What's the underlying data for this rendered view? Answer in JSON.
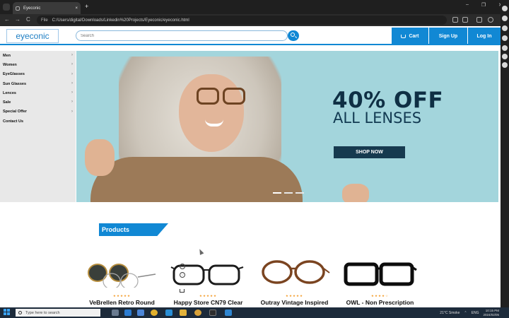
{
  "browser": {
    "tab_title": "Eyeconic",
    "tab_close": "×",
    "new_tab": "+",
    "file_chip": "File",
    "url": "C:/Users/digital/Downloads/Linkedin%20Projects/Eyeconic/eyeconic.html",
    "nav": {
      "back": "←",
      "forward": "→",
      "reload": "C"
    },
    "window": {
      "minimize": "–",
      "maximize": "❐",
      "close": "✕"
    }
  },
  "header": {
    "logo": "eyeconic",
    "search_placeholder": "Search",
    "cart_label": "Cart",
    "signup_label": "Sign Up",
    "login_label": "Log In"
  },
  "sidebar": {
    "items": [
      {
        "label": "Men"
      },
      {
        "label": "Women"
      },
      {
        "label": "EyeGlasses"
      },
      {
        "label": "Sun Glasses"
      },
      {
        "label": "Lences"
      },
      {
        "label": "Sale"
      },
      {
        "label": "Special Offer"
      },
      {
        "label": "Contact Us"
      }
    ],
    "chevron": "›"
  },
  "hero": {
    "headline": "40% OFF",
    "subheadline": "ALL LENSES",
    "cta": "SHOP NOW"
  },
  "products": {
    "section_title": "Products",
    "items": [
      {
        "name": "VeBrellen Retro Round",
        "stars": "★★★★★"
      },
      {
        "name": "Happy Store CN79 Clear",
        "stars": "★★★★★"
      },
      {
        "name": "Outray Vintage Inspired",
        "stars": "★★★★★"
      },
      {
        "name": "OWL - Non Prescription",
        "stars": "★★★★☆"
      }
    ],
    "heart_icon": "♡"
  },
  "taskbar": {
    "search_placeholder": "Type here to search",
    "weather": "21°C  Smoke",
    "lang": "ENG",
    "time": "10:15 PM",
    "date": "2024/02/05"
  },
  "colors": {
    "brand_blue": "#1188d4",
    "hero_bg": "#a3d5dc",
    "hero_text": "#0f2f44",
    "star": "#f39b27"
  }
}
